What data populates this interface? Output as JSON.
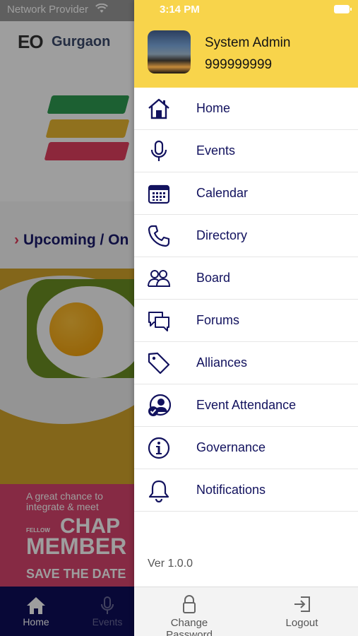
{
  "status_bar": {
    "carrier": "Network Provider",
    "time": "3:14 PM"
  },
  "background_app": {
    "logo_text": "EO",
    "city": "Gurgaon",
    "section_title": "Upcoming / On",
    "banner": {
      "line1": "A great chance to",
      "line2": "integrate & meet",
      "fellow": "FELLOW",
      "chapter": "CHAP",
      "members": "MEMBER",
      "save": "SAVE THE DATE"
    },
    "tabs": [
      {
        "label": "Home",
        "icon": "home-icon"
      },
      {
        "label": "Events",
        "icon": "microphone-icon"
      }
    ]
  },
  "drawer": {
    "user": {
      "name": "System Admin",
      "phone": "999999999"
    },
    "menu": [
      {
        "label": "Home",
        "icon": "home-icon"
      },
      {
        "label": "Events",
        "icon": "microphone-icon"
      },
      {
        "label": "Calendar",
        "icon": "calendar-icon"
      },
      {
        "label": "Directory",
        "icon": "phone-icon"
      },
      {
        "label": "Board",
        "icon": "users-icon"
      },
      {
        "label": "Forums",
        "icon": "chat-bubbles-icon"
      },
      {
        "label": "Alliances",
        "icon": "tag-icon"
      },
      {
        "label": "Event Attendance",
        "icon": "user-check-icon"
      },
      {
        "label": "Governance",
        "icon": "info-icon"
      },
      {
        "label": "Notifications",
        "icon": "bell-icon"
      }
    ],
    "version": "Ver 1.0.0",
    "footer": {
      "change_password": "Change Password",
      "logout": "Logout"
    }
  },
  "colors": {
    "header_yellow": "#f8d44b",
    "menu_text_navy": "#12125e",
    "tab_bar_navy": "#0d0d5a",
    "accent_pink": "#e03a5a"
  }
}
